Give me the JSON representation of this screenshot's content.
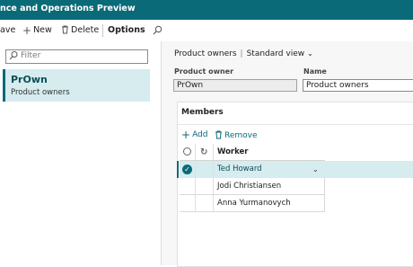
{
  "app": {
    "title": "nce and Operations Preview"
  },
  "toolbar": {
    "save_label": "ave",
    "new_label": "New",
    "delete_label": "Delete",
    "options_label": "Options"
  },
  "left_pane": {
    "filter_placeholder": "Filter",
    "items": [
      {
        "name": "PrOwn",
        "description": "Product owners"
      }
    ]
  },
  "header": {
    "breadcrumb_title": "Product owners",
    "view_name": "Standard view"
  },
  "form": {
    "product_owner_label": "Product owner",
    "product_owner_value": "PrOwn",
    "name_label": "Name",
    "name_value": "Product owners"
  },
  "members": {
    "title": "Members",
    "add_label": "Add",
    "remove_label": "Remove",
    "column_worker": "Worker",
    "rows": [
      {
        "worker": "Ted Howard",
        "selected": true
      },
      {
        "worker": "Jodi Christiansen",
        "selected": false
      },
      {
        "worker": "Anna Yurmanovych",
        "selected": false
      }
    ]
  },
  "colors": {
    "brand": "#0b6a77",
    "selection": "#d6ecef"
  },
  "icons": {
    "search": "search-icon",
    "new": "plus-icon",
    "delete": "trash-icon",
    "filter": "search-icon",
    "add": "plus-icon",
    "remove": "trash-icon",
    "view_dropdown": "chevron-down-icon",
    "row_check": "check-icon",
    "refresh": "refresh-icon"
  }
}
